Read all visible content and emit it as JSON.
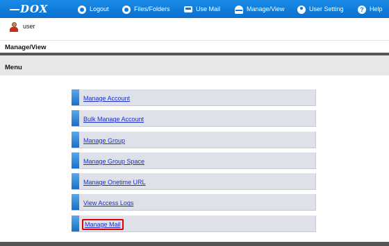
{
  "header": {
    "logo": "DOX",
    "nav": [
      {
        "label": "Logout",
        "icon": "logout-icon"
      },
      {
        "label": "Files/Folders",
        "icon": "files-folders-icon"
      },
      {
        "label": "Use Mail",
        "icon": "mail-icon"
      },
      {
        "label": "Manage/View",
        "icon": "manage-view-icon"
      },
      {
        "label": "User Setting",
        "icon": "user-setting-icon"
      },
      {
        "label": "Help",
        "icon": "help-icon"
      }
    ]
  },
  "user": {
    "name": "user",
    "icon": "user-avatar-icon"
  },
  "page": {
    "title": "Manage/View",
    "section": "Menu"
  },
  "menu": {
    "items": [
      {
        "label": "Manage Account"
      },
      {
        "label": "Bulk Manage Account"
      },
      {
        "label": "Manage Group"
      },
      {
        "label": "Manage Group Space"
      },
      {
        "label": "Manage Onetime URL"
      },
      {
        "label": "View Access Logs"
      },
      {
        "label": "Manage Mail",
        "highlighted": true
      }
    ]
  },
  "colors": {
    "header_blue": "#0a78da",
    "link": "#1a2ecc",
    "highlight_border": "#e00000"
  }
}
